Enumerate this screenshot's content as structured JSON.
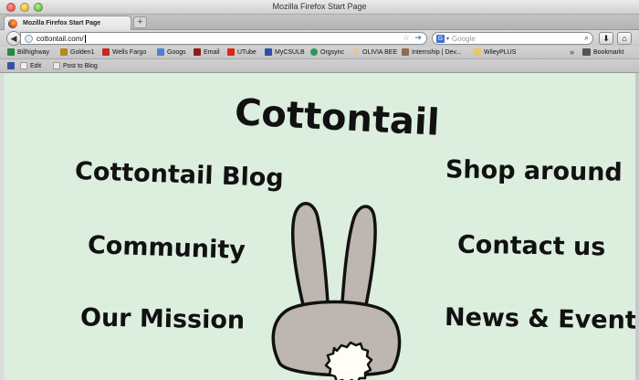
{
  "window": {
    "title": "Mozilla Firefox Start Page"
  },
  "tabs": [
    {
      "label": "Mozilla Firefox Start Page"
    }
  ],
  "new_tab_label": "+",
  "tab_close_label": "×",
  "address_bar": {
    "value": "cottontail.com/"
  },
  "search_bar": {
    "placeholder": "Google"
  },
  "bookmarks": {
    "items": [
      {
        "label": "Billhighway"
      },
      {
        "label": "Golden1"
      },
      {
        "label": "Wells Fargo"
      },
      {
        "label": "Googs"
      },
      {
        "label": "Email"
      },
      {
        "label": "UTube"
      },
      {
        "label": "MyCSULB"
      },
      {
        "label": "Orgsync"
      },
      {
        "label": "OLIVIA BEE"
      },
      {
        "label": "Internship | Dev..."
      },
      {
        "label": "WileyPLUS"
      }
    ],
    "overflow": "»",
    "folder_label": "Bookmarkt"
  },
  "addon_bar": {
    "items": [
      {
        "label": "Edit"
      },
      {
        "label": "Post to Blog"
      }
    ]
  },
  "site": {
    "title": "Cottontail",
    "nav": {
      "blog": "Cottontail Blog",
      "community": "Community",
      "mission": "Our Mission",
      "shop": "Shop around",
      "contact": "Contact us",
      "news": "News & Events"
    }
  },
  "colors": {
    "page_background": "#dceede",
    "bunny_fur": "#bdb6b1",
    "bunny_tail": "#fffdf6",
    "ink": "#111111"
  }
}
